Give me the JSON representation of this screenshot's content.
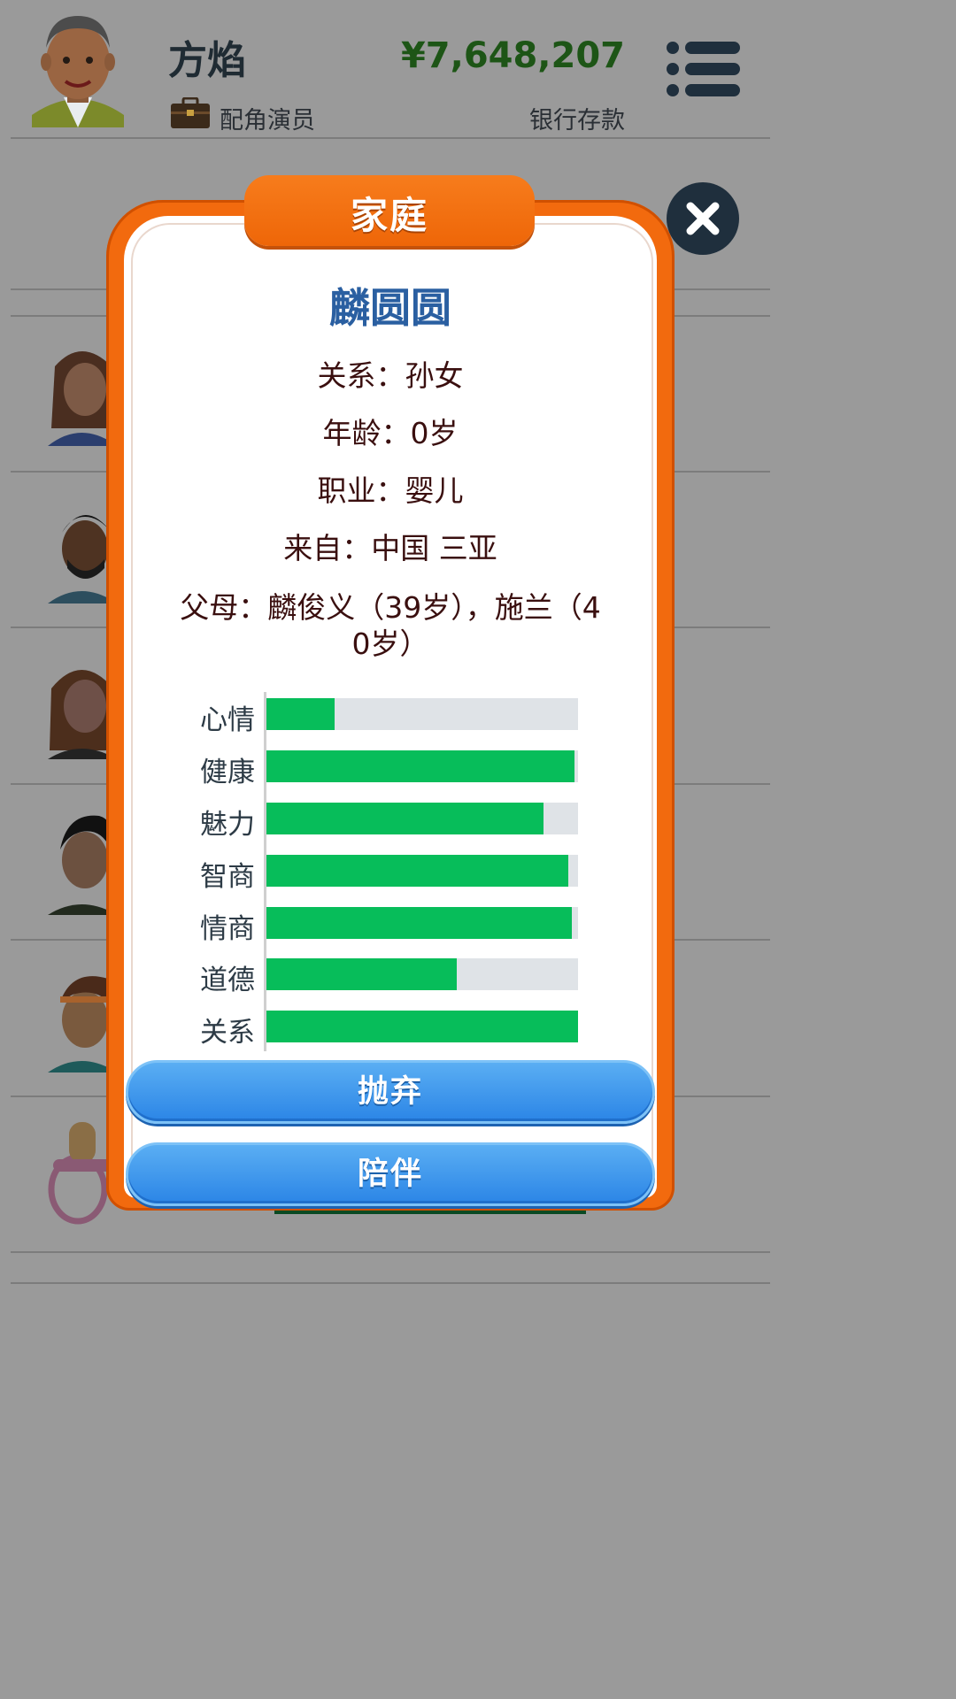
{
  "header": {
    "player_name": "方焰",
    "job": "配角演员",
    "money": "¥7,648,207",
    "bank_label": "银行存款"
  },
  "dialog": {
    "tab_title": "家庭",
    "person_name": "麟圆圆",
    "info_lines": [
      "关系：孙女",
      "年龄：0岁",
      "职业：婴儿",
      "来自：中国 三亚",
      "父母：麟俊义（39岁），施兰（4",
      "0岁）"
    ],
    "stats": [
      {
        "label": "心情",
        "value": 22
      },
      {
        "label": "健康",
        "value": 99
      },
      {
        "label": "魅力",
        "value": 89
      },
      {
        "label": "智商",
        "value": 97
      },
      {
        "label": "情商",
        "value": 98
      },
      {
        "label": "道德",
        "value": 61
      },
      {
        "label": "关系",
        "value": 100
      }
    ],
    "buttons": {
      "abandon": "抛弃",
      "accompany": "陪伴"
    }
  },
  "colors": {
    "accent_orange": "#f26a0e",
    "stat_fill": "#07bd5a",
    "money_green": "#1d5516",
    "button_blue": "#2b85e6"
  },
  "icons": [
    "menu-icon",
    "close-icon",
    "briefcase-icon"
  ]
}
